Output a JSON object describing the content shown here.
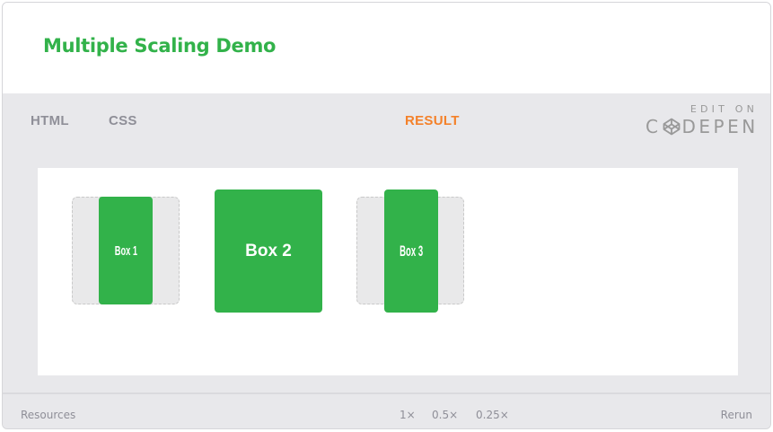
{
  "title": "Multiple Scaling Demo",
  "tabs": {
    "html": "HTML",
    "css": "CSS",
    "result": "RESULT"
  },
  "codepen": {
    "edit_on": "EDIT ON",
    "brand_start": "C",
    "brand_end": "DEPEN"
  },
  "boxes": [
    "Box 1",
    "Box 2",
    "Box 3"
  ],
  "footer": {
    "resources": "Resources",
    "scales": [
      "1×",
      "0.5×",
      "0.25×"
    ],
    "rerun": "Rerun"
  },
  "colors": {
    "accent": "#32b24a",
    "active_tab": "#f4812a",
    "muted": "#8f8f98"
  }
}
